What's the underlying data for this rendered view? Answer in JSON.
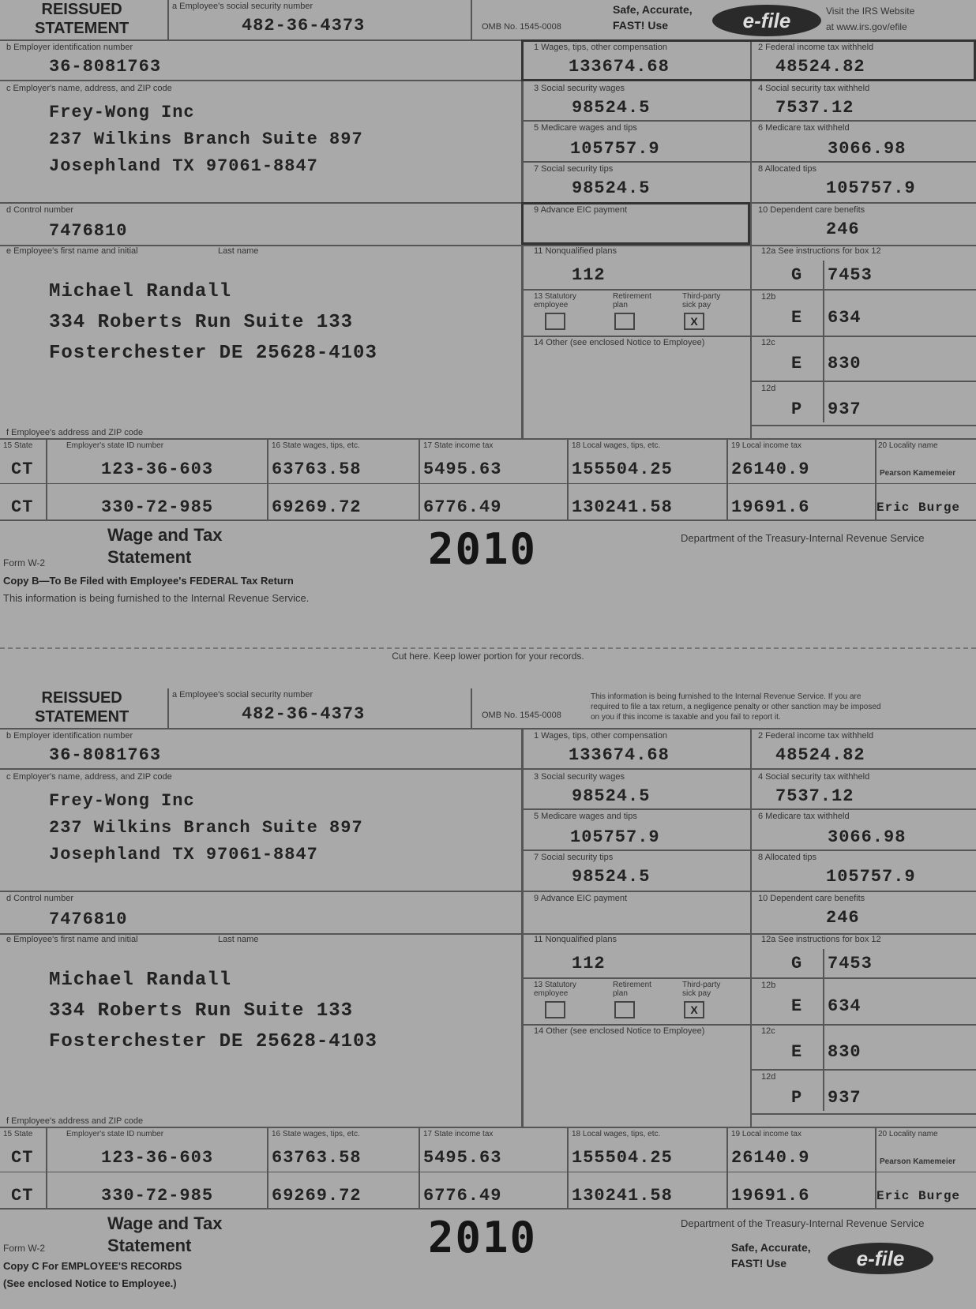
{
  "copy_b": {
    "reissued": [
      "REISSUED",
      "STATEMENT"
    ],
    "ssn_label": "a Employee's social security number",
    "ssn": "482-36-4373",
    "omb": "OMB No. 1545-0008",
    "safe": [
      "Safe, Accurate,",
      "FAST! Use"
    ],
    "efile": "e-file",
    "irs_visit": [
      "Visit the IRS Website",
      "at www.irs.gov/efile"
    ],
    "ein_label": "b Employer identification number",
    "ein": "36-8081763",
    "employer_label": "c Employer's name, address, and ZIP code",
    "employer": [
      "Frey-Wong Inc",
      "237 Wilkins Branch Suite 897",
      "Josephland  TX  97061-8847"
    ],
    "control_label": "d Control number",
    "control": "7476810",
    "emp_name_label": "e Employee's first name and initial",
    "last_name_label": "Last name",
    "employee": [
      "Michael  Randall",
      "334 Roberts Run Suite 133",
      "Fosterchester  DE  25628-4103"
    ],
    "emp_addr_label": "f Employee's address and ZIP code",
    "box1_label": "1 Wages, tips, other compensation",
    "box1": "133674.68",
    "box2_label": "2 Federal income tax withheld",
    "box2": "48524.82",
    "box3_label": "3 Social security wages",
    "box3": "98524.5",
    "box4_label": "4 Social security tax withheld",
    "box4": "7537.12",
    "box5_label": "5 Medicare wages and tips",
    "box5": "105757.9",
    "box6_label": "6 Medicare tax withheld",
    "box6": "3066.98",
    "box7_label": "7 Social security tips",
    "box7": "98524.5",
    "box8_label": "8 Allocated tips",
    "box8": "105757.9",
    "box9_label": "9 Advance EIC payment",
    "box10_label": "10 Dependent care benefits",
    "box10": "246",
    "box11_label": "11 Nonqualified plans",
    "box11": "112",
    "box12_label": "12a See instructions for box 12",
    "box12_sub": [
      "12b",
      "12c",
      "12d"
    ],
    "box12": [
      {
        "code": "G",
        "amount": "7453"
      },
      {
        "code": "E",
        "amount": "634"
      },
      {
        "code": "E",
        "amount": "830"
      },
      {
        "code": "P",
        "amount": "937"
      }
    ],
    "box13_labels": [
      "13 Statutory employee",
      "Retirement plan",
      "Third-party sick pay"
    ],
    "box13_checks": [
      "",
      "",
      "X"
    ],
    "box14_label": "14 Other (see enclosed Notice to Employee)",
    "state_headers": [
      "15 State",
      "Employer's state ID number",
      "16 State wages, tips, etc.",
      "17 State income tax",
      "18 Local wages, tips, etc.",
      "19 Local income tax",
      "20 Locality name"
    ],
    "state_rows": [
      {
        "state": "CT",
        "id": "123-36-603",
        "wages": "63763.58",
        "tax": "5495.63",
        "lwages": "155504.25",
        "ltax": "26140.9",
        "loc": "Pearson Kamemeier"
      },
      {
        "state": "CT",
        "id": "330-72-985",
        "wages": "69269.72",
        "tax": "6776.49",
        "lwages": "130241.58",
        "ltax": "19691.6",
        "loc": "Eric Burge"
      }
    ],
    "title": [
      "Wage and Tax",
      "Statement"
    ],
    "year": "2010",
    "form": "Form W-2",
    "dept": "Department of the Treasury-Internal Revenue Service",
    "copy_line": "Copy B—To Be Filed with Employee's FEDERAL Tax Return",
    "info_line": "This information is being furnished to the Internal Revenue Service."
  },
  "cut_text": "Cut here. Keep lower portion for your records.",
  "copy_c": {
    "notice": [
      "This information is being furnished to the Internal Revenue Service. If you are",
      "required to file a tax return, a negligence penalty or other sanction may be imposed",
      "on you if this income is taxable and you fail to report it."
    ],
    "copy_line": "Copy C For EMPLOYEE'S RECORDS",
    "copy_line2": "(See enclosed Notice to Employee.)"
  }
}
